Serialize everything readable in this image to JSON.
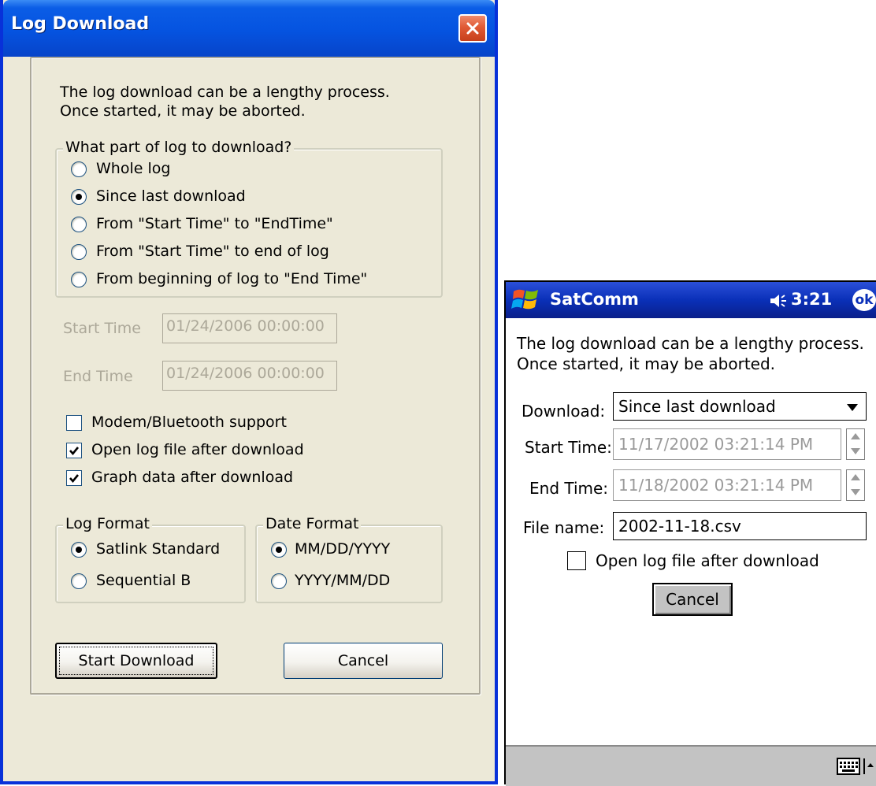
{
  "dialog": {
    "title": "Log Download",
    "intro_line1": "The log download can be a lengthy process.",
    "intro_line2": "Once started, it may be aborted.",
    "range_group": {
      "legend": "What part of log to download?",
      "options": [
        {
          "label": "Whole log",
          "selected": false
        },
        {
          "label": "Since last download",
          "selected": true
        },
        {
          "label": "From \"Start Time\" to \"EndTime\"",
          "selected": false
        },
        {
          "label": "From \"Start Time\" to end of log",
          "selected": false
        },
        {
          "label": "From beginning of log to \"End Time\"",
          "selected": false
        }
      ]
    },
    "start_time": {
      "label": "Start Time",
      "value": "01/24/2006 00:00:00"
    },
    "end_time": {
      "label": "End Time",
      "value": "01/24/2006 00:00:00"
    },
    "checkboxes": [
      {
        "label": "Modem/Bluetooth support",
        "checked": false
      },
      {
        "label": "Open log file after download",
        "checked": true
      },
      {
        "label": "Graph data after download",
        "checked": true
      }
    ],
    "log_format": {
      "legend": "Log Format",
      "options": [
        {
          "label": "Satlink Standard",
          "selected": true
        },
        {
          "label": "Sequential B",
          "selected": false
        }
      ]
    },
    "date_format": {
      "legend": "Date Format",
      "options": [
        {
          "label": "MM/DD/YYYY",
          "selected": true
        },
        {
          "label": "YYYY/MM/DD",
          "selected": false
        }
      ]
    },
    "start_button": "Start Download",
    "cancel_button": "Cancel"
  },
  "ppc": {
    "app_title": "SatComm",
    "clock": "3:21",
    "ok_label": "ok",
    "intro_line1": "The log download can be a lengthy process.",
    "intro_line2": "Once started, it may be aborted.",
    "download_label": "Download:",
    "download_value": "Since last download",
    "start_label": "Start Time:",
    "start_value": "11/17/2002 03:21:14 PM",
    "end_label": "End Time:",
    "end_value": "11/18/2002 03:21:14 PM",
    "file_label": "File name:",
    "file_value": "2002-11-18.csv",
    "open_log_label": "Open log file after download",
    "open_log_checked": false,
    "cancel_button": "Cancel"
  },
  "icons": [
    "close-icon",
    "windows-flag-icon",
    "speaker-icon",
    "keyboard-icon",
    "caret-up-icon",
    "dropdown-arrow-icon",
    "spin-up-icon",
    "spin-down-icon",
    "checkmark-icon"
  ],
  "colors": {
    "xp_title_blue": "#0553e0",
    "dialog_face": "#ece9d8",
    "close_red": "#e05a35",
    "ppc_title_blue": "#0a30b8"
  }
}
